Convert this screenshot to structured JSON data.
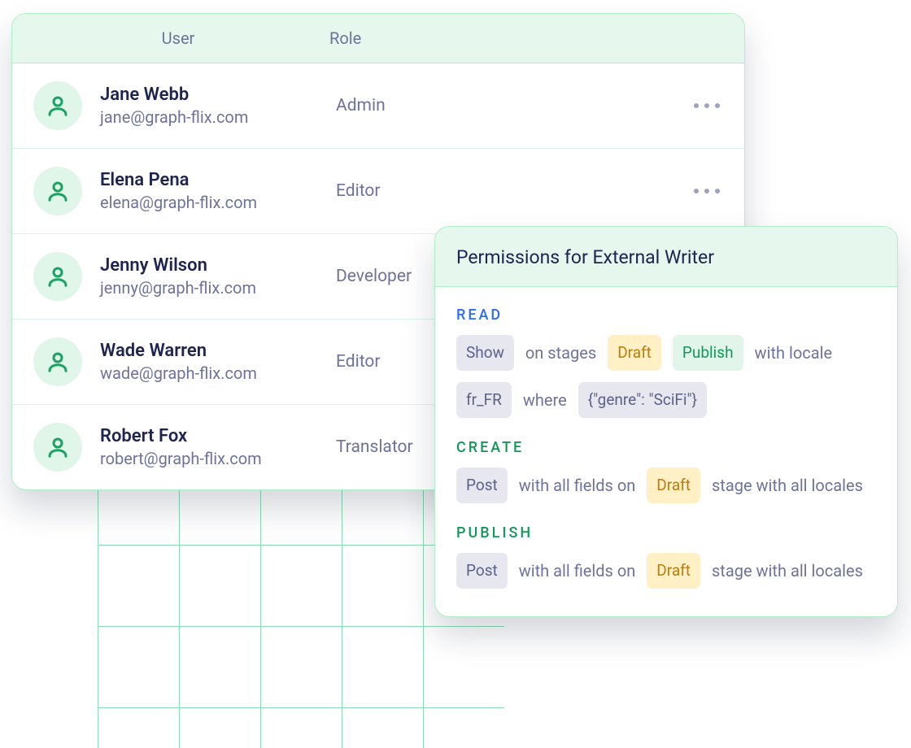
{
  "users_table": {
    "header": {
      "user": "User",
      "role": "Role"
    },
    "rows": [
      {
        "name": "Jane Webb",
        "email": "jane@graph-flix.com",
        "role": "Admin",
        "show_more": true
      },
      {
        "name": "Elena Pena",
        "email": "elena@graph-flix.com",
        "role": "Editor",
        "show_more": true
      },
      {
        "name": "Jenny Wilson",
        "email": "jenny@graph-flix.com",
        "role": "Developer",
        "show_more": false
      },
      {
        "name": "Wade Warren",
        "email": "wade@graph-flix.com",
        "role": "Editor",
        "show_more": false
      },
      {
        "name": "Robert Fox",
        "email": "robert@graph-flix.com",
        "role": "Translator",
        "show_more": false
      }
    ]
  },
  "permissions_card": {
    "title": "Permissions for External Writer",
    "sections": [
      {
        "label": "READ",
        "color": "blue",
        "tokens": [
          {
            "type": "chip-gray",
            "text": "Show"
          },
          {
            "type": "text",
            "text": "on stages"
          },
          {
            "type": "chip-yellow",
            "text": "Draft"
          },
          {
            "type": "chip-green",
            "text": "Publish"
          },
          {
            "type": "text",
            "text": "with locale"
          },
          {
            "type": "chip-gray",
            "text": "fr_FR"
          },
          {
            "type": "text",
            "text": "where"
          },
          {
            "type": "chip-gray",
            "text": "{\"genre\": \"SciFi\"}"
          }
        ]
      },
      {
        "label": "CREATE",
        "color": "green",
        "tokens": [
          {
            "type": "chip-gray",
            "text": "Post"
          },
          {
            "type": "text",
            "text": "with all fields on"
          },
          {
            "type": "chip-yellow",
            "text": "Draft"
          },
          {
            "type": "text",
            "text": "stage with all locales"
          }
        ]
      },
      {
        "label": "PUBLISH",
        "color": "green",
        "tokens": [
          {
            "type": "chip-gray",
            "text": "Post"
          },
          {
            "type": "text",
            "text": "with all fields on"
          },
          {
            "type": "chip-yellow",
            "text": "Draft"
          },
          {
            "type": "text",
            "text": "stage with all locales"
          }
        ]
      }
    ]
  },
  "icons": {
    "avatar": "user-icon",
    "more": "more-horizontal-icon"
  }
}
